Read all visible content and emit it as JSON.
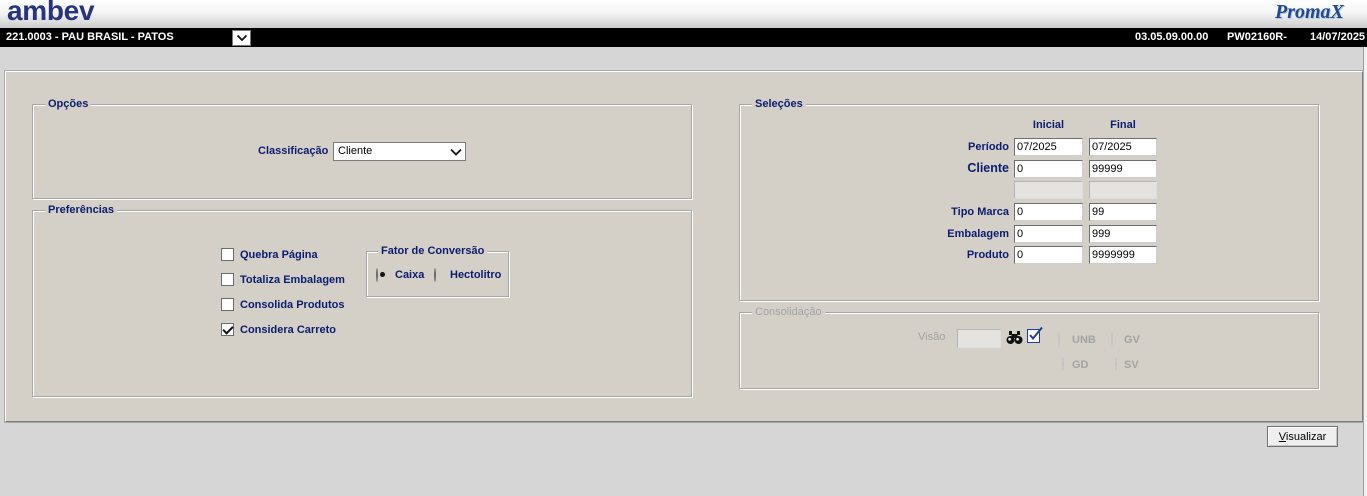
{
  "header": {
    "logo_left": "ambev",
    "logo_right": "PromaX"
  },
  "context": {
    "unit": "221.0003 - PAU BRASIL - PATOS",
    "version": "03.05.09.00.00",
    "program": "PW02160R-",
    "date": "14/07/2025"
  },
  "opcoes": {
    "legend": "Opções",
    "classificacao_label": "Classificação",
    "classificacao_value": "Cliente"
  },
  "preferencias": {
    "legend": "Preferências",
    "checkboxes": [
      {
        "label": "Quebra Página",
        "checked": false
      },
      {
        "label": "Totaliza Embalagem",
        "checked": false
      },
      {
        "label": "Consolida Produtos",
        "checked": false
      },
      {
        "label": "Considera Carreto",
        "checked": true
      }
    ],
    "fator_conversao": {
      "legend": "Fator de Conversão",
      "options": [
        {
          "label": "Caixa",
          "checked": true
        },
        {
          "label": "Hectolitro",
          "checked": false
        }
      ]
    }
  },
  "selecoes": {
    "legend": "Seleções",
    "col_inicial": "Inicial",
    "col_final": "Final",
    "rows": [
      {
        "label": "Período",
        "inicial": "07/2025",
        "final": "07/2025"
      },
      {
        "label": "Cliente",
        "inicial": "0",
        "final": "99999"
      },
      {
        "label": "",
        "inicial": "",
        "final": ""
      },
      {
        "label": "Tipo Marca",
        "inicial": "0",
        "final": "99"
      },
      {
        "label": "Embalagem",
        "inicial": "0",
        "final": "999"
      },
      {
        "label": "Produto",
        "inicial": "0",
        "final": "9999999"
      }
    ]
  },
  "consolidacao": {
    "legend": "Consolidação",
    "disabled": true,
    "visao_label": "Visão",
    "visao_value": "",
    "icons": [
      "binoculars-icon",
      "edit-check-icon"
    ],
    "options": [
      {
        "label": "UNB",
        "checked": false
      },
      {
        "label": "GV",
        "checked": false
      },
      {
        "label": "GD",
        "checked": false
      },
      {
        "label": "SV",
        "checked": false
      }
    ]
  },
  "actions": {
    "visualizar_label": "Visualizar"
  },
  "colors": {
    "label_text": "#0c1c6e",
    "panel": "#d4d0c8",
    "disabled_text": "#a3a3a3",
    "logo": "#27337d",
    "context_bar": "#000000"
  }
}
